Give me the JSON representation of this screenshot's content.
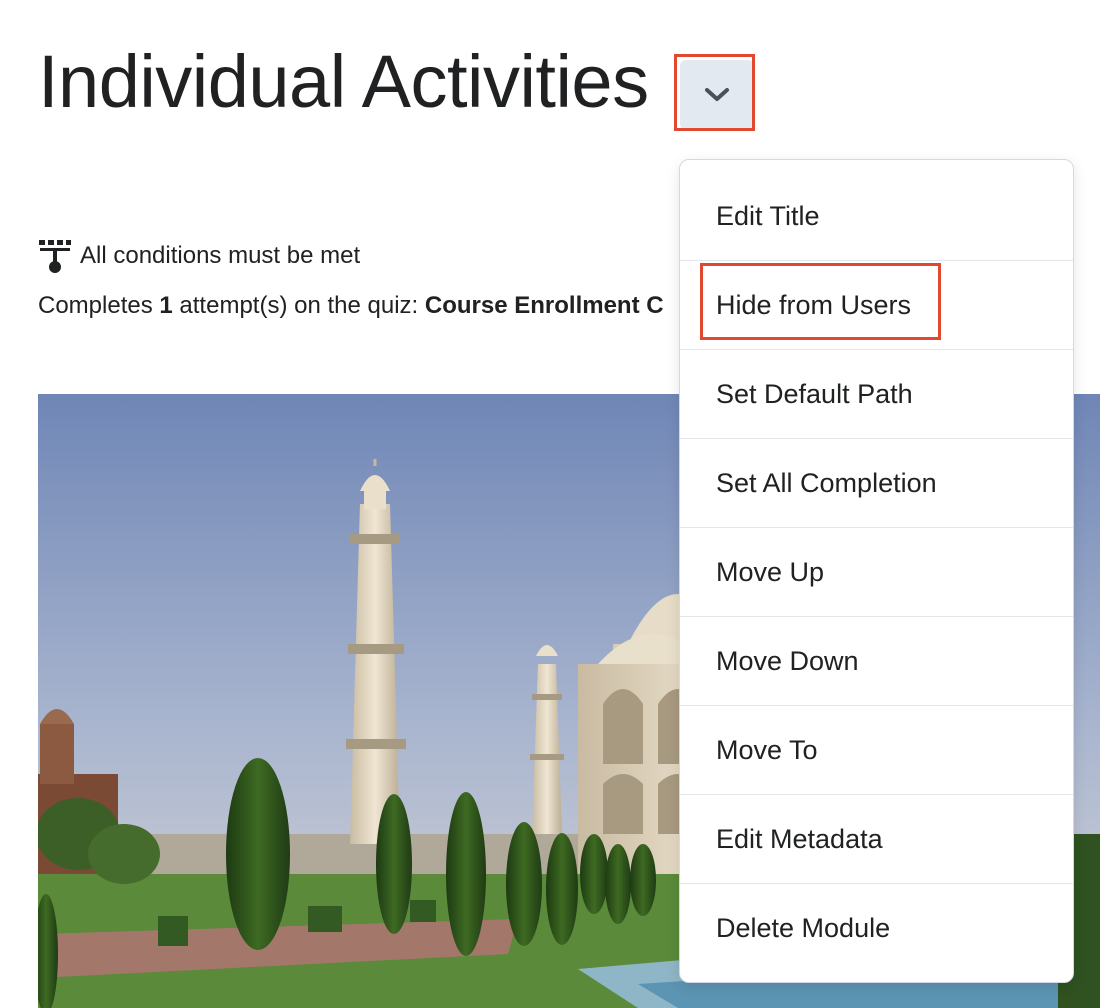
{
  "module": {
    "title": "Individual Activities"
  },
  "release_conditions": {
    "summary": "All conditions must be met",
    "condition_prefix": "Completes",
    "attempt_count": "1",
    "condition_middle": " attempt(s) on the quiz: ",
    "quiz_name": "Course Enrollment C"
  },
  "context_menu": {
    "items": [
      {
        "label": "Edit Title"
      },
      {
        "label": "Hide from Users"
      },
      {
        "label": "Set Default Path"
      },
      {
        "label": "Set All Completion"
      },
      {
        "label": "Move Up"
      },
      {
        "label": "Move Down"
      },
      {
        "label": "Move To"
      },
      {
        "label": "Edit Metadata"
      },
      {
        "label": "Delete Module"
      }
    ]
  },
  "colors": {
    "highlight": "#e0482f",
    "button_bg": "#e3e9f1",
    "text": "#202122"
  },
  "icons": {
    "dropdown": "chevron-down-icon",
    "conditions": "release-conditions-icon"
  }
}
